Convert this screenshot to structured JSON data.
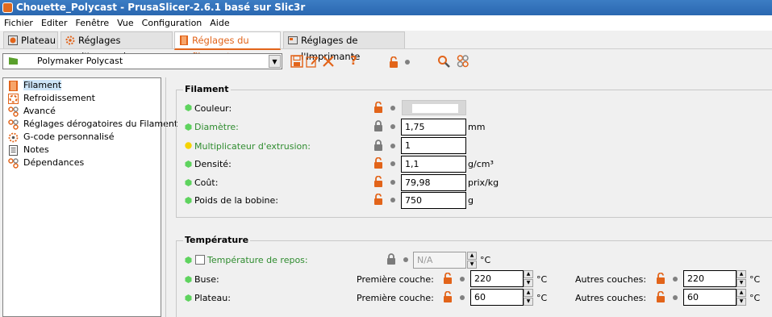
{
  "window": {
    "title": "Chouette_Polycast - PrusaSlicer-2.6.1 basé sur Slic3r"
  },
  "menu": [
    "Fichier",
    "Editer",
    "Fenêtre",
    "Vue",
    "Configuration",
    "Aide"
  ],
  "tabs": [
    {
      "label": "Plateau",
      "active": false
    },
    {
      "label": "Réglages d'Impression",
      "active": false
    },
    {
      "label": "Réglages du filament",
      "active": true
    },
    {
      "label": "Réglages de l'Imprimante",
      "active": false
    }
  ],
  "preset": {
    "name": "Polymaker Polycast",
    "flag_color": "#5aa02c"
  },
  "tree": [
    "Filament",
    "Refroidissement",
    "Avancé",
    "Réglages dérogatoires du Filament",
    "G-code personnalisé",
    "Notes",
    "Dépendances"
  ],
  "filament": {
    "title": "Filament",
    "couleur": {
      "label": "Couleur:",
      "value": ""
    },
    "diametre": {
      "label": "Diamètre:",
      "value": "1,75",
      "unit": "mm"
    },
    "extrusion": {
      "label": "Multiplicateur d'extrusion:",
      "value": "1",
      "unit": ""
    },
    "densite": {
      "label": "Densité:",
      "value": "1,1",
      "unit": "g/cm³"
    },
    "cout": {
      "label": "Coût:",
      "value": "79,98",
      "unit": "prix/kg"
    },
    "poids": {
      "label": "Poids de la bobine:",
      "value": "750",
      "unit": "g"
    }
  },
  "temperature": {
    "title": "Température",
    "repos": {
      "label": "Température de repos:",
      "value": "N/A",
      "unit": "°C"
    },
    "buse": {
      "label": "Buse:",
      "first_label": "Première couche:",
      "first": "220",
      "other_label": "Autres couches:",
      "other": "220",
      "unit": "°C"
    },
    "plateau": {
      "label": "Plateau:",
      "first_label": "Première couche:",
      "first": "60",
      "other_label": "Autres couches:",
      "other": "60",
      "unit": "°C"
    }
  },
  "colors": {
    "accent": "#e2641a",
    "green": "#2f8c2f",
    "bullet_green": "#5ed35e",
    "bullet_yellow": "#f5d300"
  }
}
